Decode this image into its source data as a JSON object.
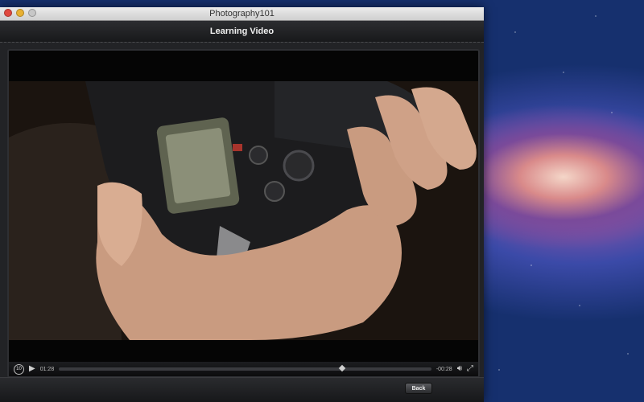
{
  "window": {
    "title": "Photography101"
  },
  "header": {
    "title": "Learning Video"
  },
  "player": {
    "elapsed": "01:28",
    "remaining": "-00:28",
    "progress": 0.76,
    "replay_label": "10"
  },
  "footer": {
    "back_label": "Back"
  },
  "colors": {
    "window_bg": "#1b1c1e",
    "desktop": "#1b3d86"
  }
}
